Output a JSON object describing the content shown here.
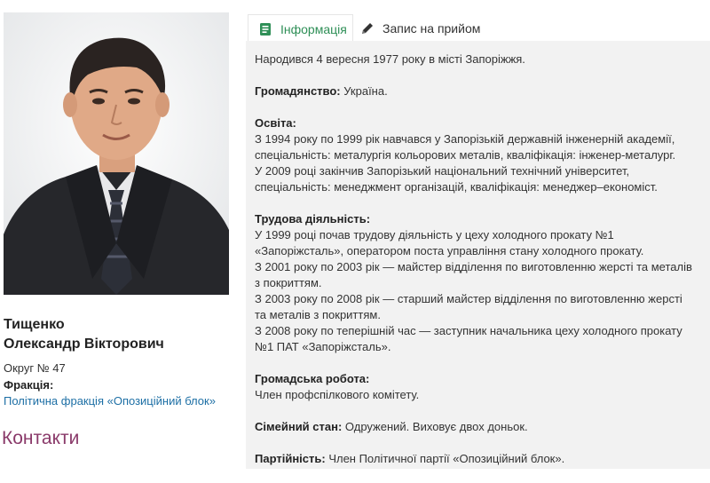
{
  "profile": {
    "last_name": "Тищенко",
    "first_middle": "Олександр Вікторович",
    "district": "Округ № 47",
    "faction_label": "Фракція:",
    "faction_link": "Політична фракція «Опозиційний блок»",
    "contacts_heading": "Контакти"
  },
  "tabs": [
    {
      "label": "Інформація",
      "icon": "document-icon",
      "active": true
    },
    {
      "label": "Запис на прийом",
      "icon": "pencil-icon",
      "active": false
    }
  ],
  "bio": {
    "born": "Народився 4 вересня 1977 року в місті Запоріжжя.",
    "citizenship_label": "Громадянство:",
    "citizenship_value": " Україна.",
    "education_label": "Освіта:",
    "education_lines": [
      "З 1994 року по 1999 рік навчався у Запорізькій державній інженерній академії,",
      "спеціальність: металургія кольорових металів, кваліфікація: інженер-металург.",
      "У 2009 році закінчив Запорізький національний технічний університет,",
      "спеціальність: менеджмент організацій, кваліфікація: менеджер–економіст."
    ],
    "work_label": "Трудова діяльність:",
    "work_lines": [
      "У 1999 році почав трудову діяльність у цеху холодного прокату №1",
      "«Запоріжсталь», оператором поста управління стану холодного прокату.",
      "З 2001 року по 2003 рік — майстер відділення по виготовленню жерсті та металів",
      "з покриттям.",
      "З 2003 року по 2008 рік — старший майстер відділення по виготовленню жерсті",
      "та металів з покриттям.",
      "З 2008 року по теперішній час — заступник начальника цеху холодного прокату",
      "№1 ПАТ «Запоріжсталь»."
    ],
    "public_label": "Громадська робота:",
    "public_value": "Член профспілкового комітету.",
    "family_label": "Сімейний стан:",
    "family_value": " Одружений. Виховує двох доньок.",
    "party_label": "Партійність:",
    "party_value": " Член Політичної партії «Опозиційний блок»."
  },
  "colors": {
    "accent_green": "#2f8f57",
    "link_blue": "#1d6fa5",
    "contacts_purple": "#8a3a6a",
    "pane_bg": "#f2f2f2"
  }
}
